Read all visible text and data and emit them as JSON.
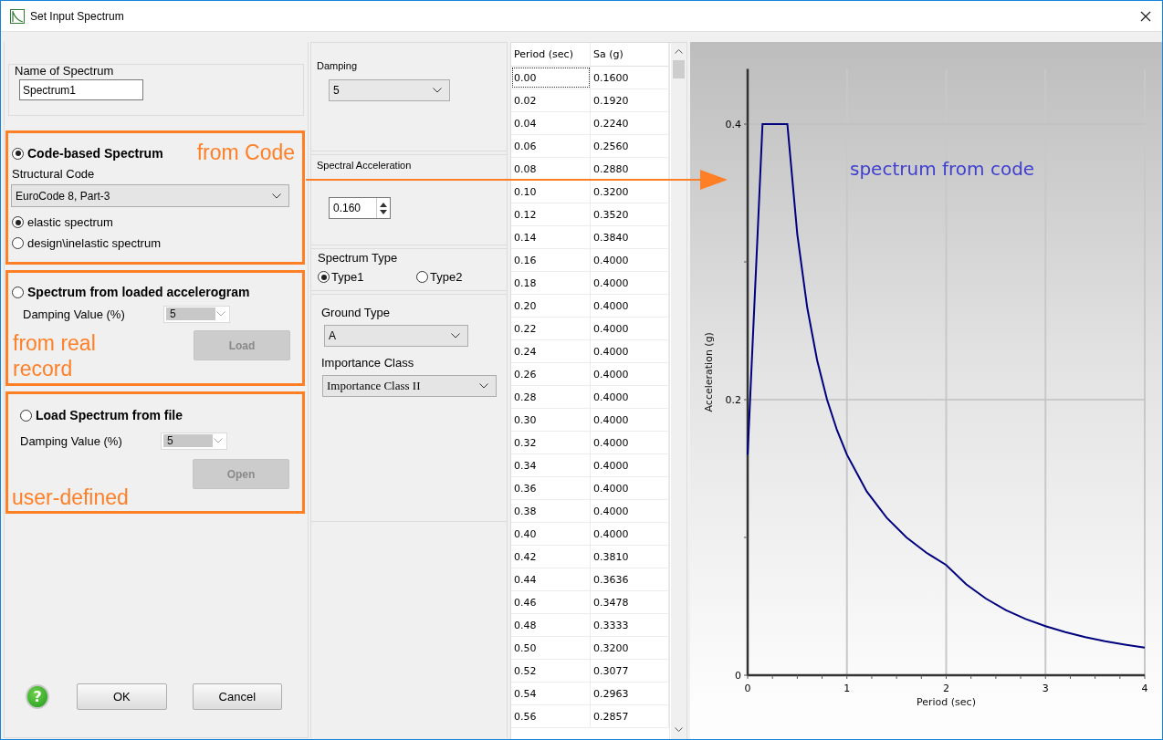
{
  "window": {
    "title": "Set Input Spectrum"
  },
  "name_group": {
    "label": "Name of Spectrum",
    "value": "Spectrum1"
  },
  "sources": [
    {
      "kind": "code",
      "label": "Code-based Spectrum",
      "selected": true,
      "note": "from Code",
      "code_label": "Structural Code",
      "code_value": "EuroCode 8, Part-3",
      "options": [
        {
          "label": "elastic spectrum",
          "selected": true
        },
        {
          "label": "design\\inelastic spectrum",
          "selected": false
        }
      ]
    },
    {
      "kind": "accelerogram",
      "label": "Spectrum from loaded accelerogram",
      "selected": false,
      "damping_label": "Damping Value (%)",
      "damping_value": "5",
      "button": {
        "label": "Load",
        "disabled": true
      },
      "note": "from real record"
    },
    {
      "kind": "file",
      "label": "Load Spectrum from file",
      "selected": false,
      "damping_label": "Damping Value (%)",
      "damping_value": "5",
      "button": {
        "label": "Open",
        "disabled": true
      },
      "note": "user-defined"
    }
  ],
  "help": {
    "glyph": "?"
  },
  "buttons": [
    {
      "label": "OK"
    },
    {
      "label": "Cancel"
    }
  ],
  "damping": {
    "label": "Damping",
    "value": "5"
  },
  "spectral_acceleration": {
    "label": "Spectral Acceleration",
    "value": "0.160"
  },
  "spectrum_type": {
    "label": "Spectrum Type",
    "options": [
      {
        "label": "Type1",
        "selected": true
      },
      {
        "label": "Type2",
        "selected": false
      }
    ]
  },
  "ground_type": {
    "label": "Ground Type",
    "value": "A"
  },
  "importance_class": {
    "label": "Importance Class",
    "value": "Importance Class II"
  },
  "table": {
    "columns": [
      "Period (sec)",
      "Sa  (g)"
    ],
    "rows": [
      {
        "period": "0.00",
        "sa": "0.1600",
        "focused": true
      },
      {
        "period": "0.02",
        "sa": "0.1920",
        "focused": false
      },
      {
        "period": "0.04",
        "sa": "0.2240",
        "focused": false
      },
      {
        "period": "0.06",
        "sa": "0.2560",
        "focused": false
      },
      {
        "period": "0.08",
        "sa": "0.2880",
        "focused": false
      },
      {
        "period": "0.10",
        "sa": "0.3200",
        "focused": false
      },
      {
        "period": "0.12",
        "sa": "0.3520",
        "focused": false
      },
      {
        "period": "0.14",
        "sa": "0.3840",
        "focused": false
      },
      {
        "period": "0.16",
        "sa": "0.4000",
        "focused": false
      },
      {
        "period": "0.18",
        "sa": "0.4000",
        "focused": false
      },
      {
        "period": "0.20",
        "sa": "0.4000",
        "focused": false
      },
      {
        "period": "0.22",
        "sa": "0.4000",
        "focused": false
      },
      {
        "period": "0.24",
        "sa": "0.4000",
        "focused": false
      },
      {
        "period": "0.26",
        "sa": "0.4000",
        "focused": false
      },
      {
        "period": "0.28",
        "sa": "0.4000",
        "focused": false
      },
      {
        "period": "0.30",
        "sa": "0.4000",
        "focused": false
      },
      {
        "period": "0.32",
        "sa": "0.4000",
        "focused": false
      },
      {
        "period": "0.34",
        "sa": "0.4000",
        "focused": false
      },
      {
        "period": "0.36",
        "sa": "0.4000",
        "focused": false
      },
      {
        "period": "0.38",
        "sa": "0.4000",
        "focused": false
      },
      {
        "period": "0.40",
        "sa": "0.4000",
        "focused": false
      },
      {
        "period": "0.42",
        "sa": "0.3810",
        "focused": false
      },
      {
        "period": "0.44",
        "sa": "0.3636",
        "focused": false
      },
      {
        "period": "0.46",
        "sa": "0.3478",
        "focused": false
      },
      {
        "period": "0.48",
        "sa": "0.3333",
        "focused": false
      },
      {
        "period": "0.50",
        "sa": "0.3200",
        "focused": false
      },
      {
        "period": "0.52",
        "sa": "0.3077",
        "focused": false
      },
      {
        "period": "0.54",
        "sa": "0.2963",
        "focused": false
      },
      {
        "period": "0.56",
        "sa": "0.2857",
        "focused": false
      }
    ]
  },
  "chart": {
    "chart_data": {
      "type": "line",
      "xlabel": "Period (sec)",
      "ylabel": "Acceleration (g)",
      "x": [
        0,
        0.05,
        0.1,
        0.15,
        0.4,
        0.5,
        0.6,
        0.7,
        0.8,
        0.9,
        1.0,
        1.2,
        1.4,
        1.6,
        1.8,
        2.0,
        2.2,
        2.4,
        2.6,
        2.8,
        3.0,
        3.2,
        3.4,
        3.6,
        3.8,
        4.0
      ],
      "series": [
        {
          "color": "#00007f",
          "values": [
            0.16,
            0.24,
            0.32,
            0.4,
            0.4,
            0.32,
            0.2667,
            0.2286,
            0.2,
            0.1778,
            0.16,
            0.1333,
            0.1143,
            0.1,
            0.0889,
            0.08,
            0.0661,
            0.0556,
            0.0473,
            0.0408,
            0.0356,
            0.0313,
            0.0277,
            0.0247,
            0.0222,
            0.02
          ]
        }
      ],
      "xlim": [
        0,
        4
      ],
      "ylim": [
        0,
        0.44
      ],
      "xticks": [
        0,
        1,
        2,
        3,
        4
      ],
      "yticks": [
        0,
        0.2,
        0.4
      ],
      "grid": true,
      "annotations": [
        "spectrum from code"
      ]
    }
  }
}
